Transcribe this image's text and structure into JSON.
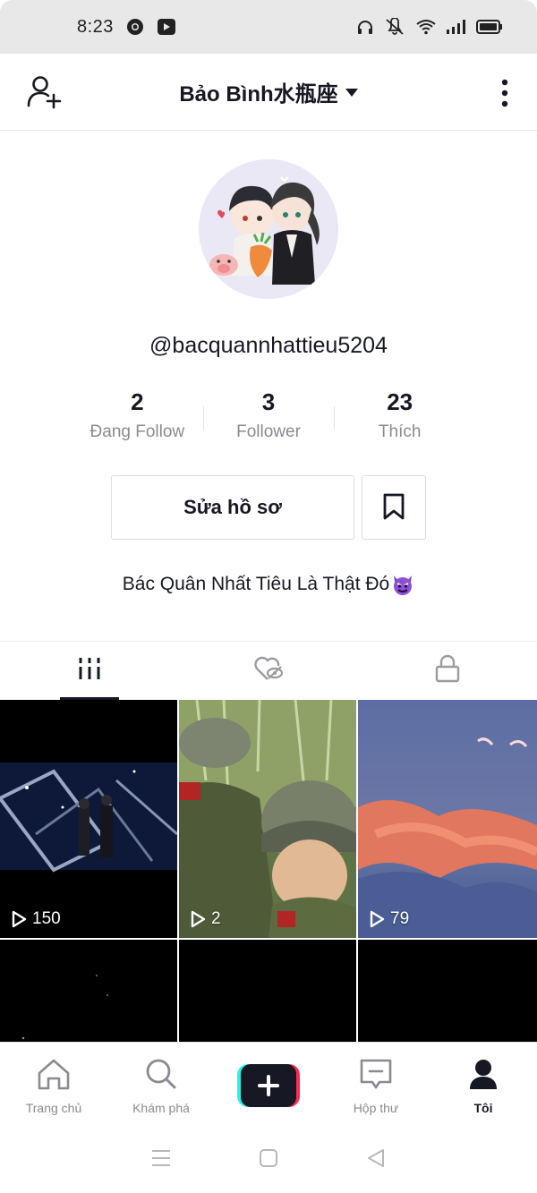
{
  "status_bar": {
    "time": "8:23",
    "icons": [
      "chrome-icon",
      "media-icon",
      "headphones-icon",
      "muted-icon",
      "wifi-icon",
      "signal-icon",
      "battery-icon"
    ]
  },
  "header": {
    "title": "Bảo Bình水瓶座",
    "left_icon": "add-user-icon",
    "right_icon": "more-vertical-icon"
  },
  "profile": {
    "username": "@bacquannhattieu5204",
    "stats": [
      {
        "value": "2",
        "label": "Đang Follow"
      },
      {
        "value": "3",
        "label": "Follower"
      },
      {
        "value": "23",
        "label": "Thích"
      }
    ],
    "edit_button": "Sửa hồ sơ",
    "bookmark_icon": "bookmark-icon",
    "bio": "Bác Quân Nhất Tiêu Là Thật Đó"
  },
  "tabs": [
    {
      "icon": "grid-icon",
      "active": true
    },
    {
      "icon": "liked-hidden-icon",
      "active": false
    },
    {
      "icon": "lock-icon",
      "active": false
    }
  ],
  "videos": [
    {
      "views": "150"
    },
    {
      "views": "2"
    },
    {
      "views": "79"
    },
    {
      "views": ""
    },
    {
      "views": ""
    },
    {
      "views": ""
    }
  ],
  "bottom_nav": [
    {
      "label": "Trang chủ",
      "icon": "home-icon",
      "active": false
    },
    {
      "label": "Khám phá",
      "icon": "search-icon",
      "active": false
    },
    {
      "label": "",
      "icon": "create-icon",
      "active": false
    },
    {
      "label": "Hộp thư",
      "icon": "inbox-icon",
      "active": false
    },
    {
      "label": "Tôi",
      "icon": "profile-icon",
      "active": true
    }
  ],
  "colors": {
    "text": "#161823",
    "muted": "#8a8b91",
    "tiktok_cyan": "#25f4ee",
    "tiktok_red": "#fe2c55"
  }
}
